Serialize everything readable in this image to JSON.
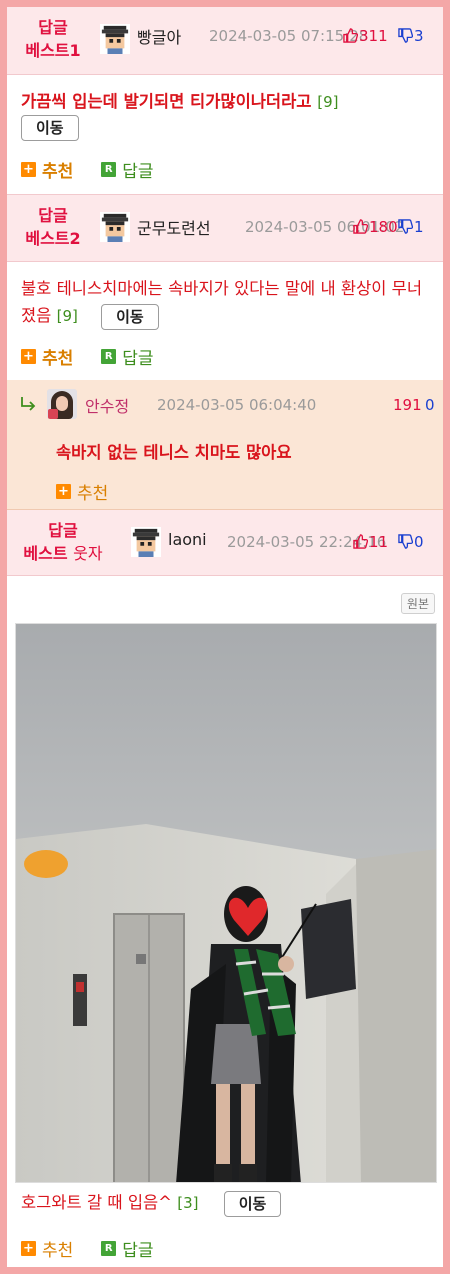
{
  "comments": [
    {
      "badge_line1": "답글",
      "badge_line2": "베스트1",
      "nickname": "빵글아",
      "date": "2024-03-05 07:15:28",
      "up": "311",
      "down": "3",
      "text": "가끔씩 입는데 발기되면 티가많이나더라고",
      "reply_count": "[9]",
      "move_label": "이동",
      "recommend_label": "추천",
      "reply_label": "답글"
    },
    {
      "badge_line1": "답글",
      "badge_line2": "베스트2",
      "nickname": "군무도련선",
      "date": "2024-03-05 06:01:02",
      "up": "180",
      "down": "1",
      "text": "불호 테니스치마에는 속바지가 있다는 말에 내 환상이 무너졌음",
      "reply_count": "[9]",
      "move_label": "이동",
      "recommend_label": "추천",
      "reply_label": "답글"
    }
  ],
  "subreply": {
    "nickname": "안수정",
    "date": "2024-03-05 06:04:40",
    "up": "191",
    "down": "0",
    "text": "속바지 없는 테니스 치마도 많아요",
    "recommend_label": "추천"
  },
  "funny": {
    "badge_line1": "답글",
    "badge_line2_bold": "베스트",
    "badge_line2_plain": "웃자",
    "nickname": "laoni",
    "date": "2024-03-05 22:24:16",
    "up": "11",
    "down": "0",
    "original_label": "원본",
    "text": "호그와트 갈 때 입음^",
    "reply_count": "[3]",
    "move_label": "이동",
    "recommend_label": "추천",
    "reply_label": "답글"
  },
  "icons": {
    "reply_arrow": "reply-arrow-icon",
    "thumb_up": "thumbs-up-icon",
    "thumb_down": "thumbs-down-icon",
    "plus": "plus-icon",
    "r_badge": "reply-r-icon"
  },
  "colors": {
    "best_bg": "#fde8ea",
    "sub_bg": "#fbe6d6",
    "accent_red": "#e0103f",
    "down_blue": "#1a3fd0",
    "reply_green": "#3e8e1e",
    "recommend_orange": "#d97f00",
    "border_pink": "#f4a7a7"
  }
}
